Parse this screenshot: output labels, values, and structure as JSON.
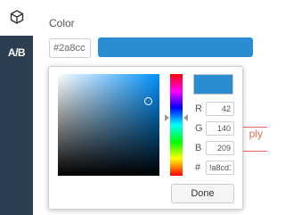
{
  "sidebar": {
    "icons": [
      {
        "icon": "cube-icon"
      },
      {
        "label": "A/B"
      }
    ]
  },
  "color_field": {
    "title": "Color",
    "hex_value": "#2a8cc",
    "swatch_color": "#2a8cd1"
  },
  "behind": {
    "apply_label": "ply"
  },
  "picker": {
    "current_color": "#2a8cd1",
    "channels": [
      {
        "label": "R",
        "value": "42"
      },
      {
        "label": "G",
        "value": "140"
      },
      {
        "label": "B",
        "value": "209"
      },
      {
        "label": "#",
        "value": "!a8cd1"
      }
    ],
    "done_label": "Done"
  }
}
